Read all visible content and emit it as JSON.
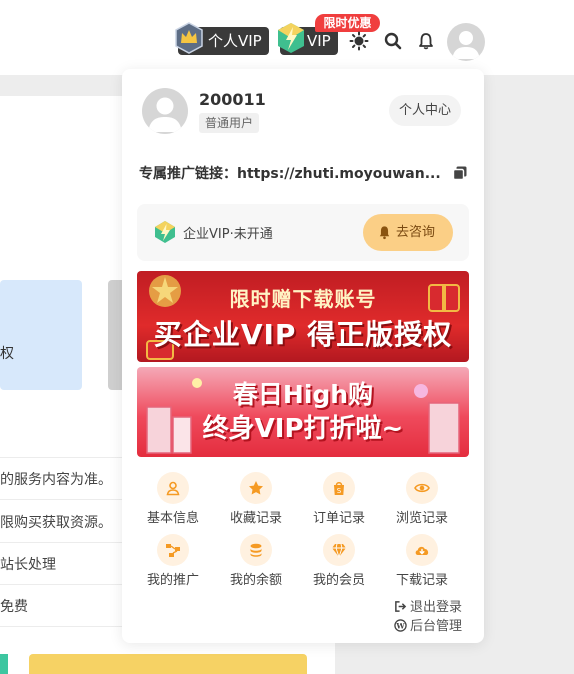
{
  "header": {
    "personal_vip_label": "个人VIP",
    "enterprise_vip_label": "VIP",
    "promo_tag": "限时优惠"
  },
  "background_page": {
    "blue_card_char": "权",
    "lines": [
      "的服务内容为准。",
      "限购买获取资源。",
      "站长处理",
      "免费"
    ]
  },
  "user_menu": {
    "username": "200011",
    "role": "普通用户",
    "center_button": "个人中心",
    "promo_link_label": "专属推广链接：",
    "promo_link_value": "https://zhuti.moyouwan...",
    "enterprise_vip_status": "企业VIP·未开通",
    "consult_button": "去咨询",
    "banners": [
      {
        "line1": "限时赠下载账号",
        "line2": "买企业VIP 得正版授权"
      },
      {
        "line1": "春日High购",
        "line2": "终身VIP打折啦~"
      }
    ],
    "grid": [
      {
        "label": "基本信息",
        "icon": "user-icon"
      },
      {
        "label": "收藏记录",
        "icon": "star-icon"
      },
      {
        "label": "订单记录",
        "icon": "shopping-bag-icon"
      },
      {
        "label": "浏览记录",
        "icon": "eye-icon"
      },
      {
        "label": "我的推广",
        "icon": "share-nodes-icon"
      },
      {
        "label": "我的余额",
        "icon": "coins-icon"
      },
      {
        "label": "我的会员",
        "icon": "diamond-icon"
      },
      {
        "label": "下载记录",
        "icon": "cloud-download-icon"
      }
    ],
    "logout": "退出登录",
    "admin": "后台管理"
  },
  "colors": {
    "accent_orange": "#f59a23",
    "consult_bg": "#fbcf86",
    "promo_red": "#f03e3e"
  }
}
